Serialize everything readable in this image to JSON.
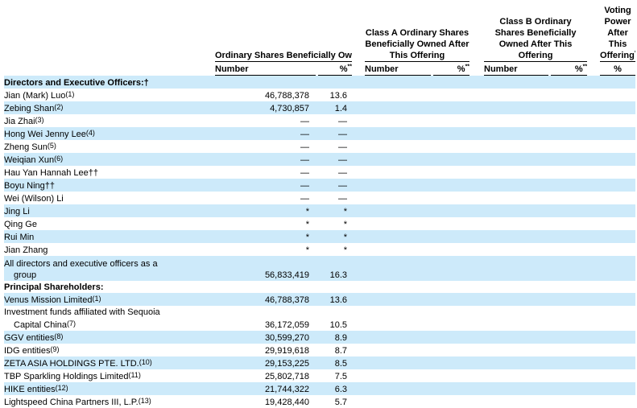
{
  "headers": {
    "prior_group": "Ordinary Shares Beneficially Owned Prior to This Offering",
    "class_a": "Class A Ordinary Shares Beneficially Owned After This Offering",
    "class_b": "Class B Ordinary Shares Beneficially Owned After This Offering",
    "voting": "Voting Power After This Offering",
    "voting_sup": "***",
    "number": "Number",
    "pct": "%",
    "pct_sup": "**"
  },
  "sections": {
    "directors": "Directors and Executive Officers:†",
    "principal": "Principal Shareholders:"
  },
  "directors": [
    {
      "name": "Jian (Mark) Luo",
      "fn": "(1)",
      "number": "46,788,378",
      "pct": "13.6"
    },
    {
      "name": "Zebing Shan",
      "fn": "(2)",
      "number": "4,730,857",
      "pct": "1.4"
    },
    {
      "name": "Jia Zhai",
      "fn": "(3)",
      "number": "—",
      "pct": "—"
    },
    {
      "name": "Hong Wei Jenny Lee",
      "fn": "(4)",
      "number": "—",
      "pct": "—"
    },
    {
      "name": "Zheng Sun",
      "fn": "(5)",
      "number": "—",
      "pct": "—"
    },
    {
      "name": "Weiqian Xun",
      "fn": "(6)",
      "number": "—",
      "pct": "—"
    },
    {
      "name": "Hau Yan Hannah Lee††",
      "fn": "",
      "number": "—",
      "pct": "—"
    },
    {
      "name": "Boyu Ning††",
      "fn": "",
      "number": "—",
      "pct": "—"
    },
    {
      "name": "Wei (Wilson) Li",
      "fn": "",
      "number": "—",
      "pct": "—"
    },
    {
      "name": "Jing Li",
      "fn": "",
      "number": "*",
      "pct": "*"
    },
    {
      "name": "Qing Ge",
      "fn": "",
      "number": "*",
      "pct": "*"
    },
    {
      "name": "Rui Min",
      "fn": "",
      "number": "*",
      "pct": "*"
    },
    {
      "name": "Jian Zhang",
      "fn": "",
      "number": "*",
      "pct": "*"
    }
  ],
  "group_total": {
    "line1": "All directors and executive officers as a",
    "line2": "group",
    "number": "56,833,419",
    "pct": "16.3"
  },
  "sequoia": {
    "line1": "Investment funds affiliated with Sequoia",
    "line2": "Capital China",
    "fn": "(7)",
    "number": "36,172,059",
    "pct": "10.5"
  },
  "principal_before": [
    {
      "name": "Venus Mission Limited",
      "fn": "(1)",
      "number": "46,788,378",
      "pct": "13.6"
    }
  ],
  "principal_after": [
    {
      "name": "GGV entities",
      "fn": "(8)",
      "number": "30,599,270",
      "pct": "8.9"
    },
    {
      "name": "IDG entities",
      "fn": "(9)",
      "number": "29,919,618",
      "pct": "8.7"
    },
    {
      "name": "ZETA ASIA HOLDINGS PTE. LTD.",
      "fn": "(10)",
      "number": "29,153,225",
      "pct": "8.5"
    },
    {
      "name": "TBP Sparkling Holdings Limited",
      "fn": "(11)",
      "number": "25,802,718",
      "pct": "7.5"
    },
    {
      "name": "HIKE entities",
      "fn": "(12)",
      "number": "21,744,322",
      "pct": "6.3"
    },
    {
      "name": "Lightspeed China Partners III, L.P.",
      "fn": "(13)",
      "number": "19,428,440",
      "pct": "5.7"
    }
  ]
}
